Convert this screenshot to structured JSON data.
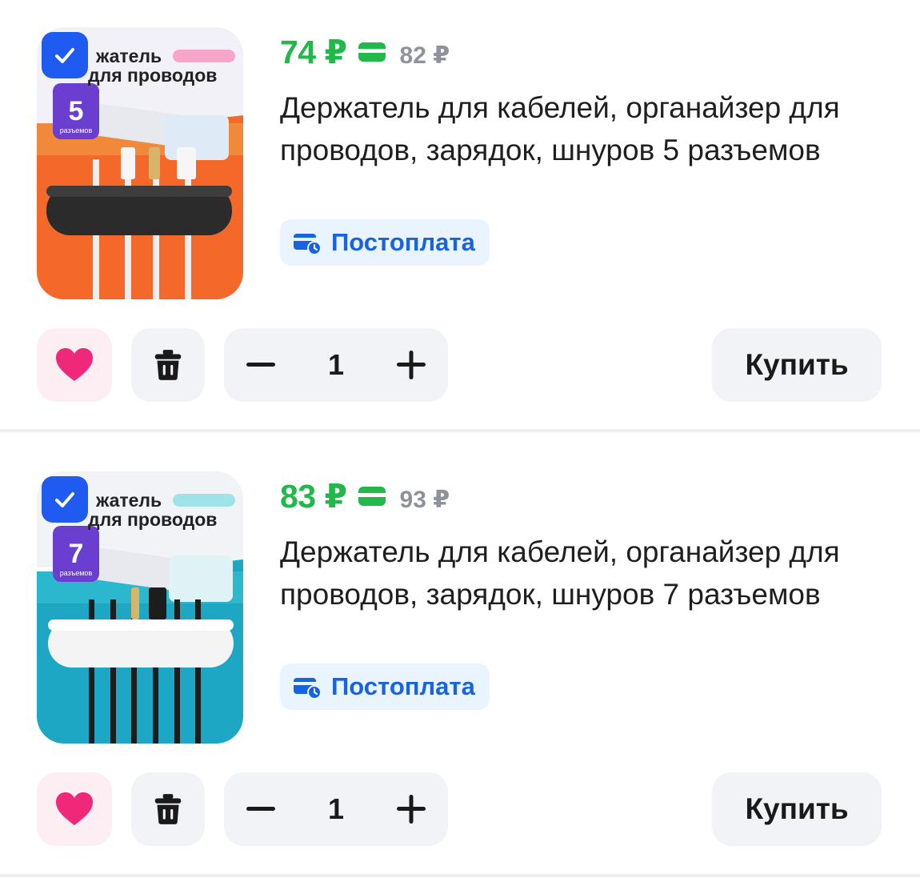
{
  "items": [
    {
      "price": "74 ₽",
      "old_price": "82 ₽",
      "title": "Держатель для кабелей, органайзер для проводов, зарядок, шнуров 5 разъемов",
      "payment_badge": "Постоплата",
      "quantity": "1",
      "buy_label": "Купить",
      "selected": true,
      "image": {
        "heading_line1": "жатель",
        "heading_line2": "для проводов",
        "slot_count": "5",
        "slot_caption": "разъемов",
        "background": "#f4692a"
      }
    },
    {
      "price": "83 ₽",
      "old_price": "93 ₽",
      "title": "Держатель для кабелей, органайзер для проводов, зарядок, шнуров 7 разъемов",
      "payment_badge": "Постоплата",
      "quantity": "1",
      "buy_label": "Купить",
      "selected": true,
      "image": {
        "heading_line1": "жатель",
        "heading_line2": "для проводов",
        "slot_count": "7",
        "slot_caption": "разъемов",
        "background": "#1ea7c4"
      }
    }
  ],
  "colors": {
    "price": "#22b84b",
    "old_price": "#8e939b",
    "accent_blue": "#1f5bf0",
    "badge_text": "#1763e0",
    "badge_bg": "#eaf4ff",
    "heart": "#f0287a",
    "button_bg": "#f2f3f6"
  },
  "icons": {
    "checkbox": "check-icon",
    "discount_card": "card-icon",
    "badge": "wallet-clock-icon",
    "favorite": "heart-icon",
    "delete": "trash-icon",
    "decrement": "minus-icon",
    "increment": "plus-icon"
  }
}
